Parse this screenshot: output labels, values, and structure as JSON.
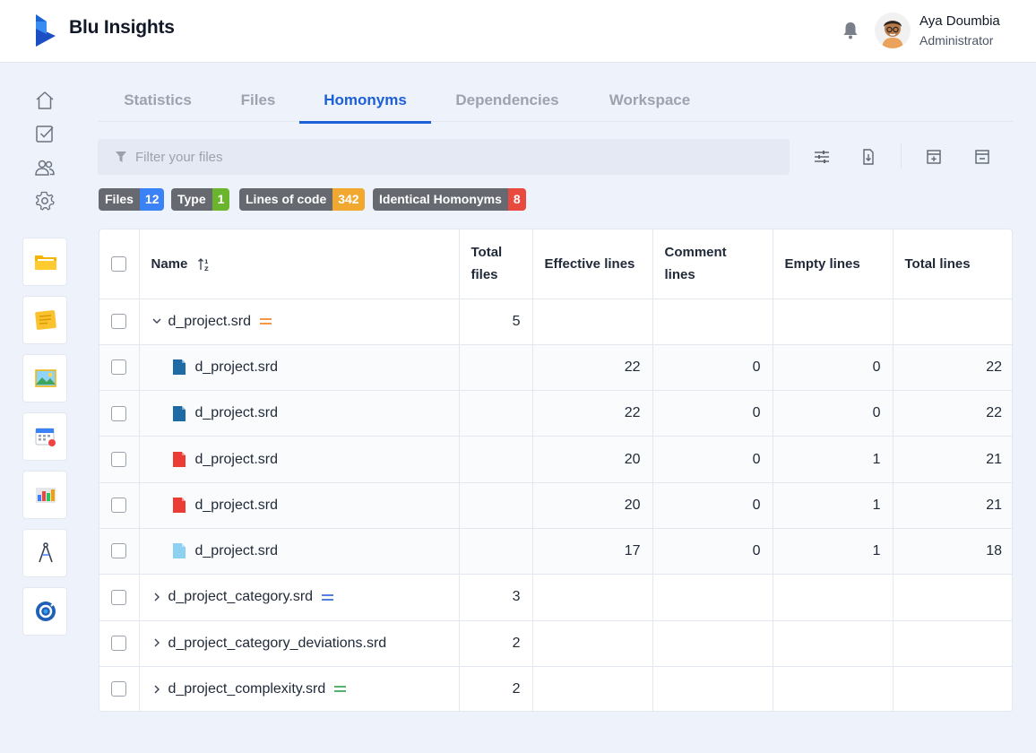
{
  "app": {
    "brand": "Blu Insights"
  },
  "user": {
    "name": "Aya Doumbia",
    "role": "Administrator"
  },
  "sidebar": {
    "nav_icons": [
      "home-icon",
      "tasks-icon",
      "users-icon",
      "settings-icon"
    ],
    "apps": [
      "folder-app-icon",
      "notes-app-icon",
      "image-app-icon",
      "calendar-app-icon",
      "dashboard-app-icon",
      "compass-app-icon",
      "cycle-app-icon"
    ]
  },
  "tabs": [
    {
      "label": "Statistics",
      "active": false
    },
    {
      "label": "Files",
      "active": false
    },
    {
      "label": "Homonyms",
      "active": true
    },
    {
      "label": "Dependencies",
      "active": false
    },
    {
      "label": "Workspace",
      "active": false
    }
  ],
  "filter": {
    "placeholder": "Filter your files"
  },
  "toolbar": [
    "settings-sliders-icon",
    "export-file-icon",
    "expand-all-icon",
    "collapse-all-icon"
  ],
  "badges": [
    {
      "label": "Files",
      "count": "12",
      "color": "#3b82f6"
    },
    {
      "label": "Type",
      "count": "1",
      "color": "#6bb52e"
    },
    {
      "label": "Lines of code",
      "count": "342",
      "color": "#f0a830"
    },
    {
      "label": "Identical Homonyms",
      "count": "8",
      "color": "#e84a3f"
    }
  ],
  "table": {
    "columns": [
      "Name",
      "Total files",
      "Effective lines",
      "Comment lines",
      "Empty lines",
      "Total lines"
    ],
    "rows": [
      {
        "type": "group",
        "expanded": true,
        "name": "d_project.srd",
        "eq_color": "#f08a2c",
        "total_files": "5",
        "effective": "",
        "comment": "",
        "empty": "",
        "total": ""
      },
      {
        "type": "child",
        "icon_color": "#1d6aa5",
        "name": "d_project.srd",
        "total_files": "",
        "effective": "22",
        "comment": "0",
        "empty": "0",
        "total": "22"
      },
      {
        "type": "child",
        "icon_color": "#1d6aa5",
        "name": "d_project.srd",
        "total_files": "",
        "effective": "22",
        "comment": "0",
        "empty": "0",
        "total": "22"
      },
      {
        "type": "child",
        "icon_color": "#ea3b35",
        "name": "d_project.srd",
        "total_files": "",
        "effective": "20",
        "comment": "0",
        "empty": "1",
        "total": "21"
      },
      {
        "type": "child",
        "icon_color": "#ea3b35",
        "name": "d_project.srd",
        "total_files": "",
        "effective": "20",
        "comment": "0",
        "empty": "1",
        "total": "21"
      },
      {
        "type": "child",
        "icon_color": "#8ed0ef",
        "name": "d_project.srd",
        "total_files": "",
        "effective": "17",
        "comment": "0",
        "empty": "1",
        "total": "18"
      },
      {
        "type": "group",
        "expanded": false,
        "name": "d_project_category.srd",
        "eq_color": "#3b6fd6",
        "total_files": "3",
        "effective": "",
        "comment": "",
        "empty": "",
        "total": ""
      },
      {
        "type": "group",
        "expanded": false,
        "name": "d_project_category_deviations.srd",
        "eq_color": "",
        "total_files": "2",
        "effective": "",
        "comment": "",
        "empty": "",
        "total": ""
      },
      {
        "type": "group",
        "expanded": false,
        "name": "d_project_complexity.srd",
        "eq_color": "#3aa85a",
        "total_files": "2",
        "effective": "",
        "comment": "",
        "empty": "",
        "total": ""
      }
    ]
  }
}
